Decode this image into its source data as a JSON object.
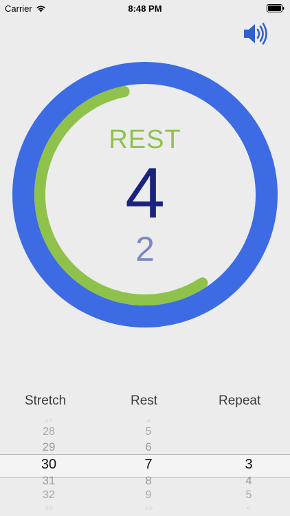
{
  "status_bar": {
    "carrier": "Carrier",
    "time": "8:48 PM"
  },
  "timer": {
    "phase": "REST",
    "count": "4",
    "sub_count": "2",
    "progress": 0.56,
    "colors": {
      "outer_ring": "#3d6be3",
      "progress_arc": "#8fc24a",
      "phase_text": "#8fc24a",
      "count_text": "#1a237e",
      "sub_count_text": "#7e86c4"
    }
  },
  "picker": {
    "headers": {
      "stretch": "Stretch",
      "rest": "Rest",
      "repeat": "Repeat"
    },
    "stretch": {
      "m3": "27",
      "m2": "28",
      "m1": "29",
      "selected": "30",
      "p1": "31",
      "p2": "32",
      "p3": "33"
    },
    "rest": {
      "m3": "4",
      "m2": "5",
      "m1": "6",
      "selected": "7",
      "p1": "8",
      "p2": "9",
      "p3": "10"
    },
    "repeat": {
      "m3": "",
      "m2": "",
      "m1": "",
      "selected": "3",
      "p1": "4",
      "p2": "5",
      "p3": "6"
    }
  },
  "icons": {
    "sound": "speaker-volume-icon",
    "wifi": "wifi-icon",
    "battery": "battery-icon"
  }
}
